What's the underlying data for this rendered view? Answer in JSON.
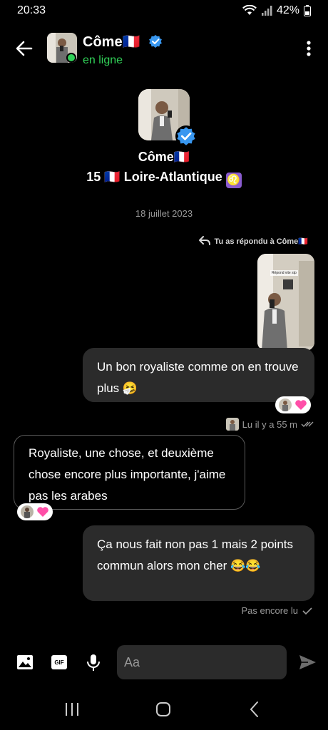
{
  "status_bar": {
    "time": "20:33",
    "battery": "42%",
    "icons": [
      "wifi-icon",
      "signal-icon",
      "battery-icon"
    ]
  },
  "header": {
    "contact_name": "Côme🇫🇷",
    "presence": "en ligne",
    "icons": [
      "back-arrow-icon",
      "verified-icon",
      "more-vertical-icon"
    ]
  },
  "profile": {
    "name": "Côme🇫🇷",
    "bio": "15 🇫🇷 Loire-Atlantique",
    "bio_badge": "♌"
  },
  "conversation": {
    "date": "18 juillet 2023",
    "reply_note": "Tu as répondu à Côme🇫🇷",
    "shared_photo_caption": "Répond vite stp",
    "messages": [
      {
        "from": "me",
        "text": "Un bon royaliste comme on en trouve plus 🤧",
        "reaction": "♥"
      },
      {
        "from": "contact",
        "text": "Royaliste, une chose, et deuxième chose encore plus importante, j'aime pas les arabes",
        "reaction": "♥"
      },
      {
        "from": "me",
        "text": "Ça nous fait non pas 1 mais 2 points commun alors mon cher 😂😂"
      }
    ],
    "read_receipt": "Lu il y a 55 m",
    "unread_status": "Pas encore lu"
  },
  "composer": {
    "placeholder": "Aa",
    "value": "",
    "icons": [
      "image-icon",
      "gif-icon",
      "microphone-icon",
      "send-icon"
    ],
    "gif_label": "GIF"
  },
  "navbar": {
    "icons": [
      "recent-apps-icon",
      "home-icon",
      "back-nav-icon"
    ]
  },
  "colors": {
    "background": "#000000",
    "outgoing_bubble": "#2b2b2b",
    "incoming_border": "#5a5a5a",
    "online": "#31d158",
    "verified": "#3897f0",
    "reaction_heart": "#ff4fa8",
    "muted_text": "#9a9a9a"
  }
}
